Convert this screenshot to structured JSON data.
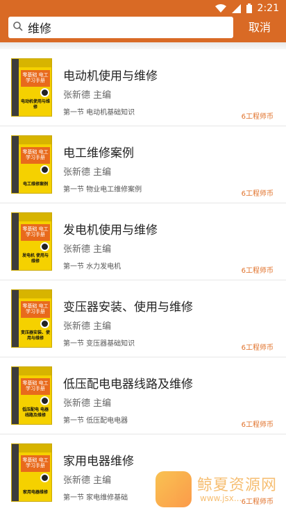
{
  "status_bar": {
    "time": "2:21"
  },
  "search": {
    "value": "维修",
    "cancel_label": "取消"
  },
  "books": [
    {
      "title": "电动机使用与维修",
      "author": "张新德  主编",
      "section": "第一节  电动机基础知识",
      "price": "6工程师币",
      "cover_title": "零基础 电工学习手册",
      "cover_sub": "电动机使用与维修"
    },
    {
      "title": "电工维修案例",
      "author": "张新德  主编",
      "section": "第一节  物业电工维修案例",
      "price": "6工程师币",
      "cover_title": "零基础 电工学习手册",
      "cover_sub": "电工维修案例"
    },
    {
      "title": "发电机使用与维修",
      "author": "张新德  主编",
      "section": "第一节  水力发电机",
      "price": "6工程师币",
      "cover_title": "零基础 电工学习手册",
      "cover_sub": "发电机 使用与维修"
    },
    {
      "title": "变压器安装、使用与维修",
      "author": "张新德  主编",
      "section": "第一节  变压器基础知识",
      "price": "6工程师币",
      "cover_title": "零基础 电工学习手册",
      "cover_sub": "变压器安装、使用与维修"
    },
    {
      "title": "低压配电电器线路及维修",
      "author": "张新德  主编",
      "section": "第一节  低压配电电器",
      "price": "6工程师币",
      "cover_title": "零基础 电工学习手册",
      "cover_sub": "低压配电 电器线路及维修"
    },
    {
      "title": "家用电器维修",
      "author": "张新德  主编",
      "section": "第一节  家电维修基础",
      "price": "6工程师币",
      "cover_title": "零基础 电工学习手册",
      "cover_sub": "家用电器维修"
    }
  ],
  "watermark": {
    "name": "鲸夏资源网",
    "url": "www.jsx..."
  }
}
